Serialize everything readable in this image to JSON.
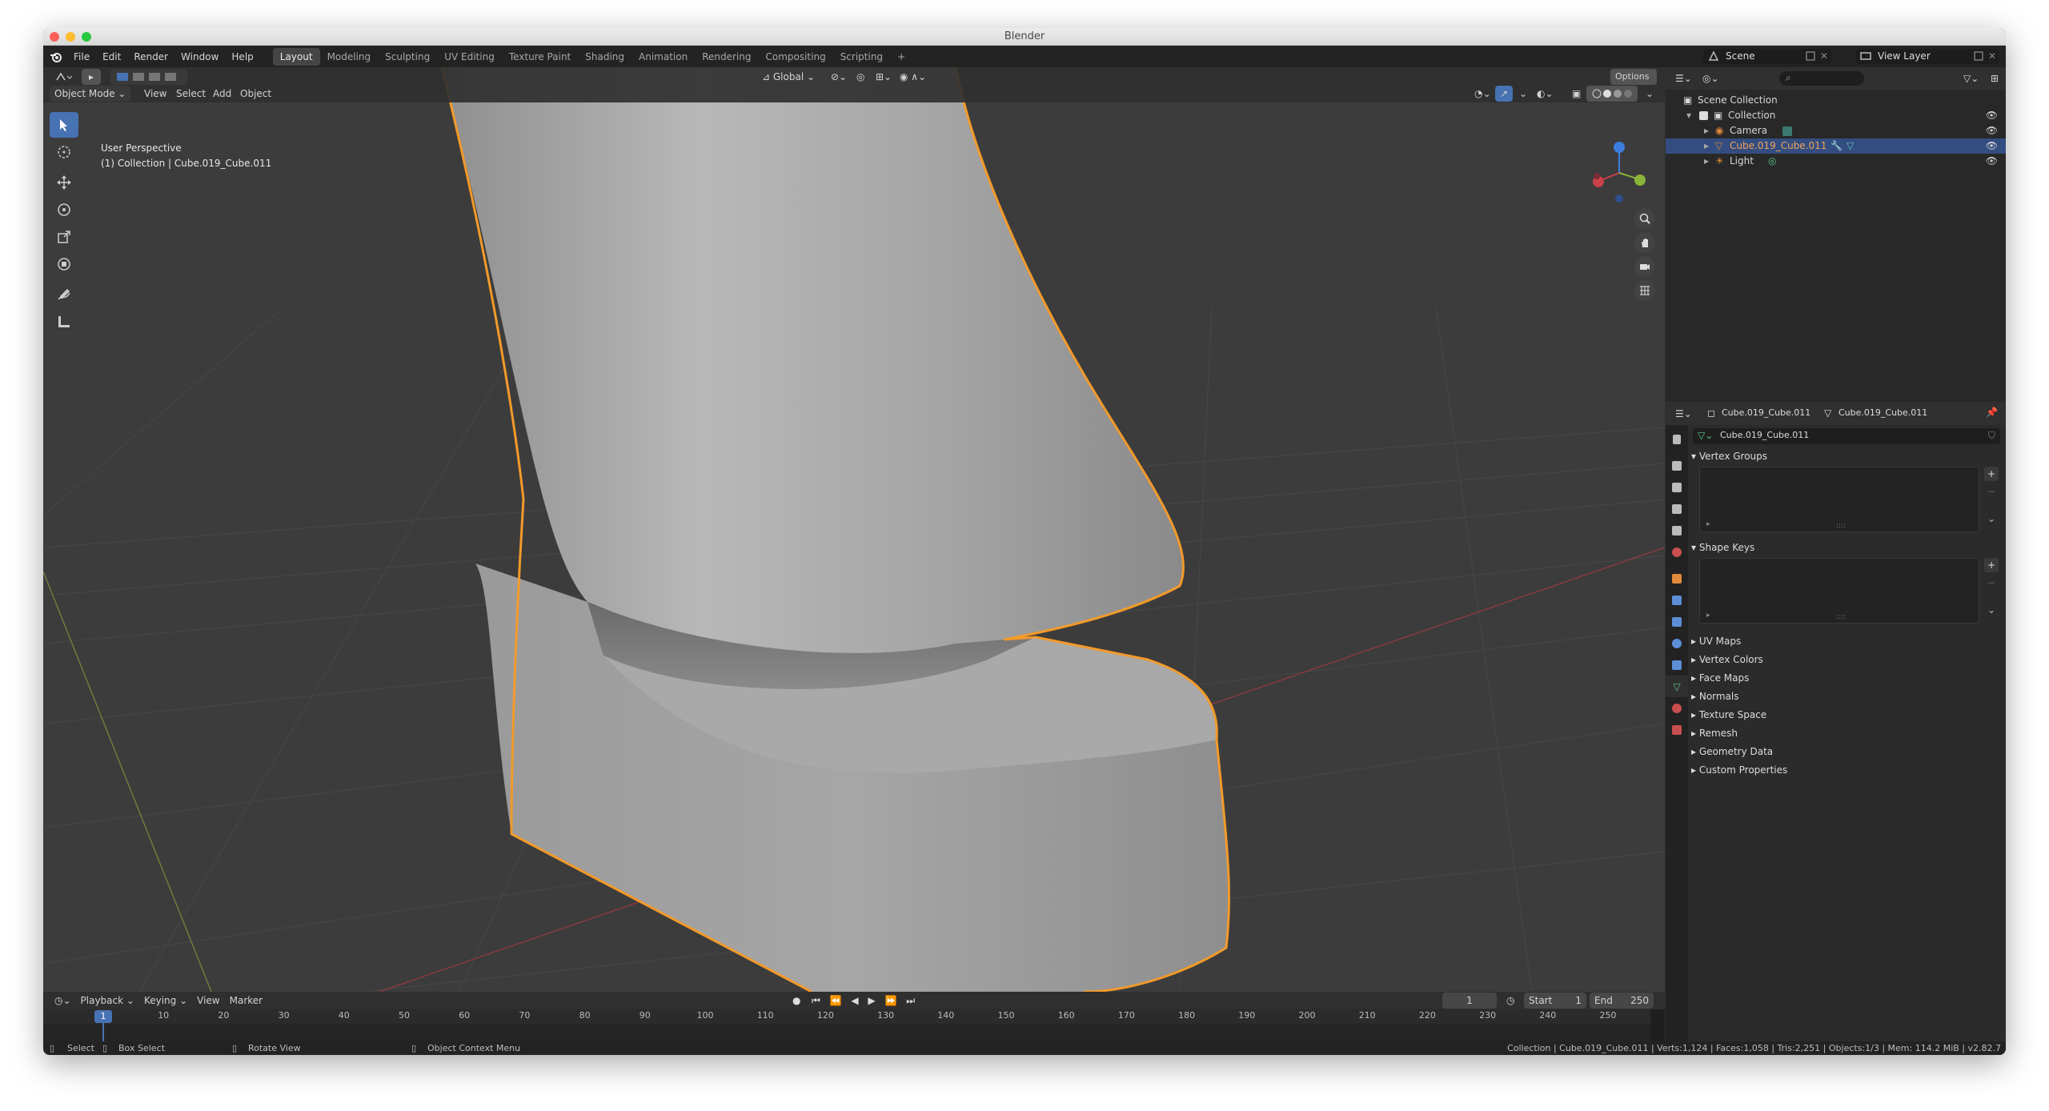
{
  "app": {
    "window_title": "Blender"
  },
  "menu": {
    "items": [
      "File",
      "Edit",
      "Render",
      "Window",
      "Help"
    ]
  },
  "workspaces": {
    "tabs": [
      "Layout",
      "Modeling",
      "Sculpting",
      "UV Editing",
      "Texture Paint",
      "Shading",
      "Animation",
      "Rendering",
      "Compositing",
      "Scripting"
    ],
    "add": "+",
    "active": "Layout"
  },
  "scene": {
    "label": "Scene",
    "view_layer": "View Layer"
  },
  "viewport": {
    "mode": "Object Mode",
    "menus": [
      "View",
      "Select",
      "Add",
      "Object"
    ],
    "transform_orientation": "Global",
    "options": "Options",
    "info_line1": "User Perspective",
    "info_line2": "(1) Collection | Cube.019_Cube.011"
  },
  "outliner": {
    "rows": [
      {
        "label": "Scene Collection"
      },
      {
        "label": "Collection"
      },
      {
        "label": "Camera"
      },
      {
        "label": "Cube.019_Cube.011",
        "selected": true
      },
      {
        "label": "Light"
      }
    ]
  },
  "properties": {
    "object_name": "Cube.019_Cube.011",
    "mesh_name": "Cube.019_Cube.011",
    "datablock": "Cube.019_Cube.011",
    "panels_expanded": [
      "Vertex Groups",
      "Shape Keys"
    ],
    "panels_collapsed": [
      "UV Maps",
      "Vertex Colors",
      "Face Maps",
      "Normals",
      "Texture Space",
      "Remesh",
      "Geometry Data",
      "Custom Properties"
    ]
  },
  "timeline": {
    "menus": [
      "Playback",
      "Keying",
      "View",
      "Marker"
    ],
    "current_frame": "1",
    "start_label": "Start",
    "start": "1",
    "end_label": "End",
    "end": "250",
    "ticks": [
      "10",
      "20",
      "30",
      "40",
      "50",
      "60",
      "70",
      "80",
      "90",
      "100",
      "110",
      "120",
      "130",
      "140",
      "150",
      "160",
      "170",
      "180",
      "190",
      "200",
      "210",
      "220",
      "230",
      "240",
      "250"
    ]
  },
  "status": {
    "select": "Select",
    "box_select": "Box Select",
    "rotate_view": "Rotate View",
    "context_menu": "Object Context Menu",
    "stats": "Collection | Cube.019_Cube.011 | Verts:1,124 | Faces:1,058 | Tris:2,251 | Objects:1/3 | Mem: 114.2 MiB | v2.82.7"
  },
  "colors": {
    "accent": "#4772b3",
    "selection_outline": "#f29a2a",
    "x_axis": "#c9414a",
    "y_axis": "#8ab53a",
    "z_axis": "#3b7ee0"
  }
}
